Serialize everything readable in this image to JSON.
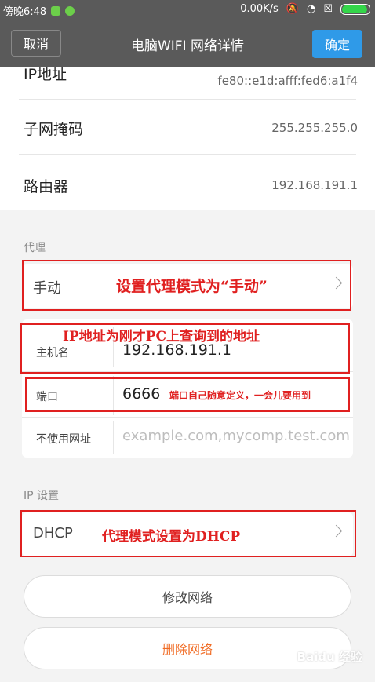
{
  "status_bar": {
    "time": "傍晚6:48",
    "network_speed": "0.00K/s"
  },
  "header": {
    "cancel_label": "取消",
    "title": "电脑WIFI  网络详情",
    "confirm_label": "确定"
  },
  "details": {
    "ip": {
      "label": "IP地址",
      "value": "fe80::e1d:afff:fed6:a1f4"
    },
    "subnet": {
      "label": "子网掩码",
      "value": "255.255.255.0"
    },
    "router": {
      "label": "路由器",
      "value": "192.168.191.1"
    }
  },
  "proxy": {
    "section_label": "代理",
    "mode_label": "手动",
    "host_label": "主机名",
    "host_value": "192.168.191.1",
    "port_label": "端口",
    "port_value": "6666",
    "bypass_label": "不使用网址",
    "bypass_placeholder": "example.com,mycomp.test.com"
  },
  "ip_settings": {
    "section_label": "IP 设置",
    "mode_label": "DHCP"
  },
  "buttons": {
    "modify": "修改网络",
    "delete": "删除网络"
  },
  "annotations": {
    "manual": "设置代理模式为“手动”",
    "host": "IP地址为刚才PC上查询到的地址",
    "port": "端口自己随意定义，一会儿要用到",
    "dhcp": "代理模式设置为DHCP"
  },
  "watermark": "Baidu 经验",
  "colors": {
    "header_bg": "#5a5a5a",
    "confirm_bg": "#2f9ae8",
    "delete_text": "#f06a22",
    "annotation_red": "#e02020"
  }
}
